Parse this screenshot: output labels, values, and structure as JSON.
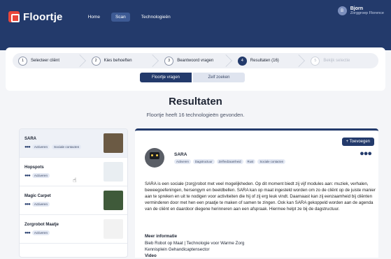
{
  "nav": {
    "brand": "Floortje",
    "links": [
      "Home",
      "Scan",
      "Technologieën"
    ],
    "active_link": 1,
    "user": {
      "initial": "B",
      "name": "Bjorn",
      "org": "Zorggroep Florence"
    }
  },
  "steps": [
    {
      "num": "1",
      "label": "Selecteer cliënt"
    },
    {
      "num": "2",
      "label": "Kies behoeften"
    },
    {
      "num": "3",
      "label": "Beantwoord vragen"
    },
    {
      "num": "4",
      "label": "Resultaten (16)"
    },
    {
      "num": "5",
      "label": "Bekijk selectie"
    }
  ],
  "toggle": {
    "on": "Floortje vragen",
    "off": "Zelf zoeken"
  },
  "results": {
    "title": "Resultaten",
    "subtitle": "Floortje heeft 16 technologieën gevonden."
  },
  "list": [
    {
      "name": "SARA",
      "tags": [
        "Activeren",
        "Sociale contacten"
      ],
      "thumb": "#6b5a44"
    },
    {
      "name": "Hopspots",
      "tags": [
        "Activeren"
      ],
      "thumb": "#e9eef2"
    },
    {
      "name": "Magic Carpet",
      "tags": [
        "Activeren"
      ],
      "thumb": "#3f5a3a"
    },
    {
      "name": "Zorgrobot Maatje",
      "tags": [
        "Activeren"
      ],
      "thumb": "#f2f2f2"
    }
  ],
  "detail": {
    "add_label": "+ Toevoegen",
    "name": "SARA",
    "tags": [
      "Activeren",
      "Dagstructuur",
      "Zelfredzaamheid",
      "Rust",
      "Sociale contacten"
    ],
    "description": "SARA is een sociale (zorg)robot met veel mogelijkheden. Op dit moment biedt zij vijf modules aan: muziek, verhalen, beweegoefeningen, hersengym en beeldbellen. SARA kan op maat ingesteld worden om zo de cliënt op de juiste manier aan te spreken en uit te nodigen voor activiteiten die hij of zij erg leuk vindt. Daarnaast kan zij eenzaamheid bij cliënten verminderen door met hen een praatje te maken of samen te zingen. Ook kan SARA gekoppeld worden aan de agenda van de cliënt en daardoor diegene herinneren aan een afspraak. Hiermee helpt ze bij de dagstructuur.",
    "more_heading": "Meer informatie",
    "more_lines": [
      "Bieb Robot op Maat | Technologie voor Warme Zorg",
      "Kennisplein Gehandicaptensector",
      "Video"
    ]
  },
  "colors": {
    "primary": "#233a6b",
    "accent": "#e9463a"
  }
}
